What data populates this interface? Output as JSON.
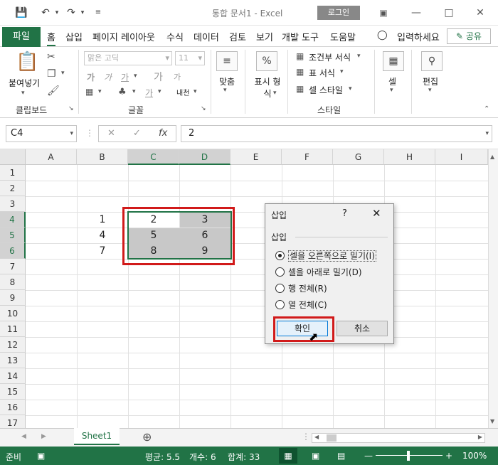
{
  "window": {
    "title": "통합 문서1  -  Excel",
    "login_label": "로그인"
  },
  "ribbon_tabs": {
    "file": "파일",
    "items": [
      "홈",
      "삽입",
      "페이지 레이아웃",
      "수식",
      "데이터",
      "검토",
      "보기",
      "개발 도구",
      "도움말"
    ],
    "tell_me": "입력하세요",
    "share": "공유"
  },
  "ribbon": {
    "paste": "붙여넣기",
    "clipboard_label": "클립보드",
    "font_name": "맑은 고딕",
    "font_size": "11",
    "font_label": "글꼴",
    "inc_font": "가",
    "dec_font": "가",
    "phonetic": "내천",
    "bold": "가",
    "italic": "가",
    "underline": "가",
    "font_color": "가",
    "align_label": "맞춤",
    "number_label": "표시 형식",
    "cond_format": "조건부 서식",
    "table_format": "표 서식",
    "cell_style": "셀 스타일",
    "style_label": "스타일",
    "cells_label": "셀",
    "edit_label": "편집"
  },
  "formula_bar": {
    "name_box": "C4",
    "fx": "fx",
    "value": "2"
  },
  "grid": {
    "columns": [
      "A",
      "B",
      "C",
      "D",
      "E",
      "F",
      "G",
      "H",
      "I"
    ],
    "rows": [
      "1",
      "2",
      "3",
      "4",
      "5",
      "6",
      "7",
      "8",
      "9",
      "10",
      "11",
      "12",
      "13",
      "14",
      "15",
      "16",
      "17"
    ],
    "cells": {
      "B4": "1",
      "C4": "2",
      "D4": "3",
      "B5": "4",
      "C5": "5",
      "D5": "6",
      "B6": "7",
      "C6": "8",
      "D6": "9"
    }
  },
  "dialog": {
    "title": "삽입",
    "help": "?",
    "group_label": "삽입",
    "options": [
      {
        "label": "셀을 오른쪽으로 밀기(I)",
        "selected": true
      },
      {
        "label": "셀을 아래로 밀기(D)",
        "selected": false
      },
      {
        "label": "행 전체(R)",
        "selected": false
      },
      {
        "label": "열 전체(C)",
        "selected": false
      }
    ],
    "ok": "확인",
    "cancel": "취소"
  },
  "sheets": {
    "active": "Sheet1"
  },
  "status": {
    "ready": "준비",
    "average": "평균: 5.5",
    "count": "개수: 6",
    "sum": "합계: 33",
    "zoom": "100%"
  },
  "colors": {
    "excel_green": "#217346",
    "highlight_red": "#d11a1a",
    "selection_gray": "#c8c8c8"
  }
}
